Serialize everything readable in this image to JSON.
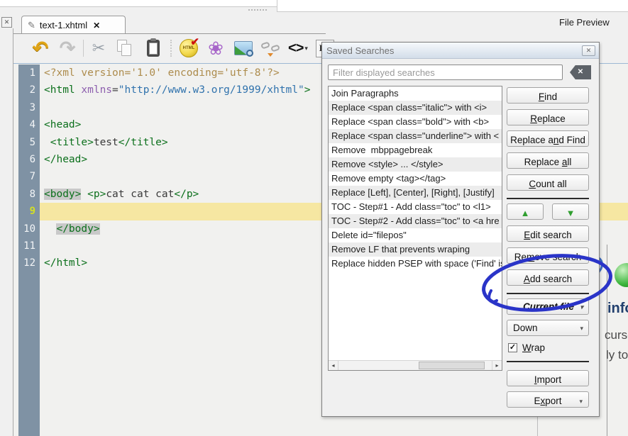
{
  "colors": {
    "annotation_blue": "#2a34c8",
    "current_line_yellow": "#f6e7a2",
    "gutter_slate": "#7f92a4",
    "tag_green": "#0c701c",
    "string_blue": "#3173ad",
    "attr_purple": "#8d5fae",
    "xml_decl_tan": "#ad8c4d",
    "tag_match_gray": "#c9c9c9"
  },
  "window": {
    "file_preview_label": "File Preview",
    "panel_close_glyph": "✕"
  },
  "tab": {
    "label": "text-1.xhtml",
    "pencil_glyph": "✎",
    "close_glyph": "✕"
  },
  "toolbar": {
    "icons": [
      {
        "name": "undo",
        "glyph": "↶"
      },
      {
        "name": "redo",
        "glyph": "↷"
      },
      {
        "name": "cut",
        "glyph": "✂"
      },
      {
        "name": "copy",
        "glyph": ""
      },
      {
        "name": "paste",
        "glyph": ""
      },
      {
        "name": "html-check",
        "glyph": "HTML",
        "check": "✔"
      },
      {
        "name": "special-character",
        "glyph": "❀"
      },
      {
        "name": "insert-image",
        "glyph": ""
      },
      {
        "name": "broken-link",
        "glyph": ""
      },
      {
        "name": "code-view",
        "glyph": "<>",
        "caret": "▾"
      },
      {
        "name": "heading",
        "glyph": "H1"
      }
    ]
  },
  "editor": {
    "lines": [
      {
        "n": 1,
        "cur": false,
        "seg": [
          [
            "pi",
            "<?xml version='1.0' encoding='utf-8'?>"
          ]
        ]
      },
      {
        "n": 2,
        "cur": false,
        "seg": [
          [
            "tag",
            "<html"
          ],
          [
            "pln",
            " "
          ],
          [
            "attr",
            "xmlns"
          ],
          [
            "pln",
            "="
          ],
          [
            "str",
            "\"http://www.w3.org/1999/xhtml\""
          ],
          [
            "tag",
            ">"
          ]
        ]
      },
      {
        "n": 3,
        "cur": false,
        "seg": []
      },
      {
        "n": 4,
        "cur": false,
        "seg": [
          [
            "tag",
            "<head>"
          ]
        ]
      },
      {
        "n": 5,
        "cur": false,
        "seg": [
          [
            "pln",
            " "
          ],
          [
            "tag",
            "<title>"
          ],
          [
            "txt",
            "test"
          ],
          [
            "tag",
            "</title>"
          ]
        ]
      },
      {
        "n": 6,
        "cur": false,
        "seg": [
          [
            "tag",
            "</head>"
          ]
        ]
      },
      {
        "n": 7,
        "cur": false,
        "seg": []
      },
      {
        "n": 8,
        "cur": false,
        "seg": [
          [
            "taghl",
            "<body>"
          ],
          [
            "pln",
            " "
          ],
          [
            "tag",
            "<p>"
          ],
          [
            "txt",
            "cat cat cat"
          ],
          [
            "tag",
            "</p>"
          ]
        ]
      },
      {
        "n": 9,
        "cur": true,
        "seg": []
      },
      {
        "n": 10,
        "cur": false,
        "seg": [
          [
            "pln",
            "  "
          ],
          [
            "taghl",
            "</body>"
          ]
        ]
      },
      {
        "n": 11,
        "cur": false,
        "seg": []
      },
      {
        "n": 12,
        "cur": false,
        "seg": [
          [
            "tag",
            "</html>"
          ]
        ]
      }
    ]
  },
  "dialog": {
    "title": "Saved Searches",
    "close_glyph": "✕",
    "filter_placeholder": "Filter displayed searches",
    "clear_glyph": "✕",
    "list": [
      "Join Paragraphs",
      "Replace <span class=\"italic\"> with <i>",
      "Replace <span class=\"bold\"> with <b>",
      "Replace <span class=\"underline\"> with <",
      "Remove  mbppagebreak",
      "Remove <style> ... </style>",
      "Remove empty <tag></tag>",
      "Replace [Left], [Center], [Right], [Justify]",
      "TOC - Step#1 - Add class=\"toc\" to <l1>",
      "TOC - Step#2 - Add class=\"toc\" to <a hre",
      "Delete id=\"filepos\"",
      "Remove LF that prevents wraping",
      "Replace hidden PSEP with space ('Find' is"
    ],
    "buttons": {
      "find": {
        "pre": "",
        "key": "F",
        "post": "ind"
      },
      "replace": {
        "pre": "",
        "key": "R",
        "post": "eplace"
      },
      "replace_and_find": {
        "pre": "Replace a",
        "key": "n",
        "post": "d Find"
      },
      "replace_all": {
        "pre": "Replace ",
        "key": "a",
        "post": "ll"
      },
      "count_all": {
        "pre": "",
        "key": "C",
        "post": "ount all"
      },
      "edit_search": {
        "pre": "",
        "key": "E",
        "post": "dit search"
      },
      "remove_search": {
        "pre": "Re",
        "key": "m",
        "post": "ove search"
      },
      "add_search": {
        "pre": "",
        "key": "A",
        "post": "dd search"
      },
      "import": {
        "pre": "",
        "key": "I",
        "post": "mport"
      },
      "export": {
        "pre": "E",
        "key": "x",
        "post": "port"
      },
      "wrap": {
        "pre": "",
        "key": "W",
        "post": "rap"
      }
    },
    "arrows": {
      "up": "▲",
      "down": "▼"
    },
    "scope_value": "Current file",
    "direction_value": "Down",
    "caret": "▾",
    "scroll": {
      "left": "◂",
      "right": "▸"
    },
    "wrap_checked": "✓"
  },
  "background": {
    "info": "info",
    "line1": "cursor",
    "line2": "ly to"
  },
  "annotation": {
    "target": "Add search button",
    "shape": "hand-drawn ellipse",
    "color": "#2a34c8"
  }
}
